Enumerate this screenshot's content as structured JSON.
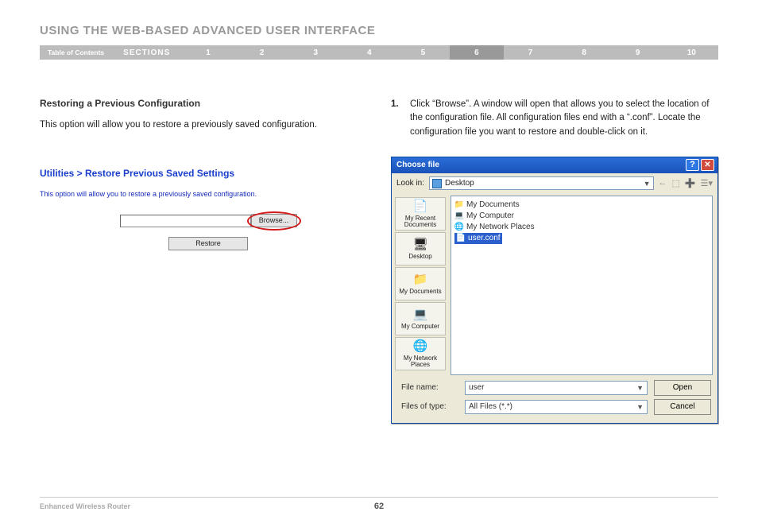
{
  "heading": "USING THE WEB-BASED ADVANCED USER INTERFACE",
  "nav": {
    "toc": "Table of Contents",
    "sections_label": "SECTIONS",
    "items": [
      "1",
      "2",
      "3",
      "4",
      "5",
      "6",
      "7",
      "8",
      "9",
      "10"
    ],
    "active_index": 5
  },
  "left": {
    "subhead": "Restoring a Previous Configuration",
    "body": "This option will allow you to restore a previously saved configuration.",
    "util": {
      "title": "Utilities > Restore Previous Saved Settings",
      "desc": "This option will allow you to restore a previously saved configuration.",
      "browse_label": "Browse...",
      "restore_label": "Restore"
    }
  },
  "right": {
    "step_number": "1.",
    "step_text": "Click “Browse”. A window will open that allows you to select the location of the configuration file. All configuration files end with a “.conf”. Locate the configuration file you want to restore and double-click on it.",
    "dialog": {
      "title": "Choose file",
      "help_glyph": "?",
      "close_glyph": "✕",
      "lookin_label": "Look in:",
      "lookin_value": "Desktop",
      "toolbar_icons": {
        "back": "←",
        "up": "⬚",
        "new_folder": "➕",
        "views": "☰▾"
      },
      "places": [
        {
          "label": "My Recent Documents",
          "icon": "📄"
        },
        {
          "label": "Desktop",
          "icon": "🖥"
        },
        {
          "label": "My Documents",
          "icon": "📁"
        },
        {
          "label": "My Computer",
          "icon": "💻"
        },
        {
          "label": "My Network Places",
          "icon": "🌐"
        }
      ],
      "files": [
        {
          "label": "My Documents",
          "icon": "📁",
          "cls": "folder-glyph"
        },
        {
          "label": "My Computer",
          "icon": "💻",
          "cls": "comp-glyph"
        },
        {
          "label": "My Network Places",
          "icon": "🌐",
          "cls": "net-glyph"
        },
        {
          "label": "user.conf",
          "icon": "📄",
          "cls": "doc-glyph",
          "selected": true
        }
      ],
      "filename_label": "File name:",
      "filename_value": "user",
      "filetype_label": "Files of type:",
      "filetype_value": "All Files (*.*)",
      "open_label": "Open",
      "cancel_label": "Cancel"
    }
  },
  "footer": {
    "product": "Enhanced Wireless Router",
    "page_number": "62"
  }
}
